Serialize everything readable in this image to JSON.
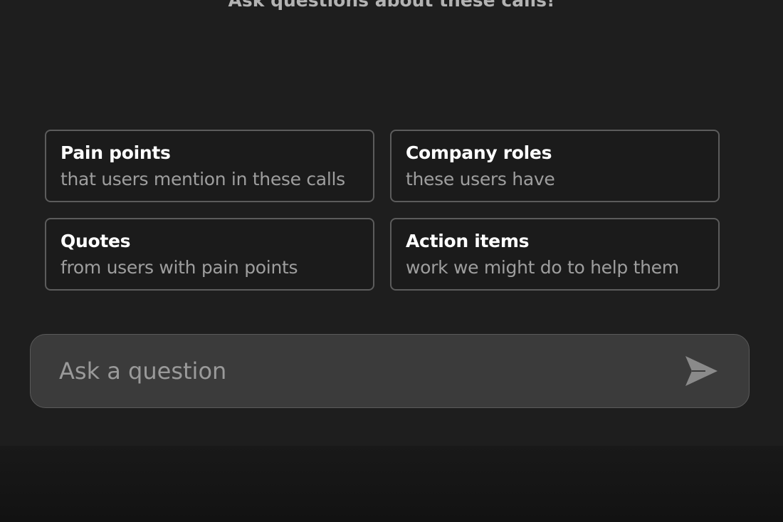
{
  "header": {
    "prompt_text": "Ask questions about these calls!"
  },
  "suggestions": [
    {
      "title": "Pain points",
      "subtitle": "that users mention in these calls"
    },
    {
      "title": "Company roles",
      "subtitle": "these users have"
    },
    {
      "title": "Quotes",
      "subtitle": "from users with pain points"
    },
    {
      "title": "Action items",
      "subtitle": "work we might do to help them"
    }
  ],
  "ask": {
    "placeholder": "Ask a question",
    "send_icon": "send-icon"
  },
  "colors": {
    "panel_background": "#1e1e1e",
    "card_border": "#5c5c5c",
    "input_background": "#3b3b3b",
    "send_icon_color": "#8a8a8a"
  }
}
